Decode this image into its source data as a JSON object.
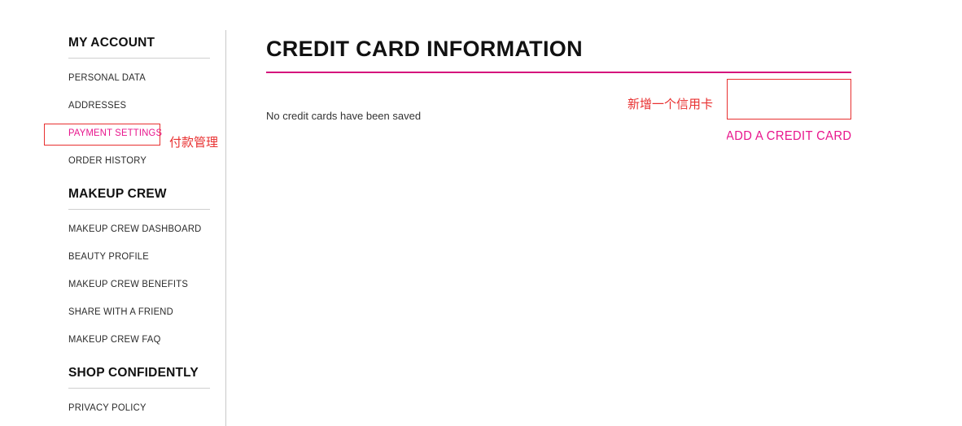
{
  "page": {
    "title": "CREDIT CARD INFORMATION",
    "empty_message": "No credit cards have been saved",
    "accent_pink": "#e8148c",
    "title_rule_color": "#d5157d",
    "annotation_color": "#e83030"
  },
  "actions": {
    "add_credit_card_label": "ADD A CREDIT CARD"
  },
  "annotations": [
    {
      "id": "payment-settings",
      "text": "付款管理",
      "target": "PAYMENT SETTINGS"
    },
    {
      "id": "add-credit-card",
      "text": "新增一个信用卡",
      "target": "ADD A CREDIT CARD"
    }
  ],
  "annotation_payment": "付款管理",
  "annotation_addcard": "新增一个信用卡",
  "sidebar": {
    "groups": [
      {
        "title": "MY ACCOUNT",
        "items": [
          {
            "label": "PERSONAL DATA",
            "active": false
          },
          {
            "label": "ADDRESSES",
            "active": false
          },
          {
            "label": "PAYMENT SETTINGS",
            "active": true
          },
          {
            "label": "ORDER HISTORY",
            "active": false
          }
        ]
      },
      {
        "title": "MAKEUP CREW",
        "items": [
          {
            "label": "MAKEUP CREW DASHBOARD",
            "active": false
          },
          {
            "label": "BEAUTY PROFILE",
            "active": false
          },
          {
            "label": "MAKEUP CREW BENEFITS",
            "active": false
          },
          {
            "label": "SHARE WITH A FRIEND",
            "active": false
          },
          {
            "label": "MAKEUP CREW FAQ",
            "active": false
          }
        ]
      },
      {
        "title": "SHOP CONFIDENTLY",
        "items": [
          {
            "label": "PRIVACY POLICY",
            "active": false
          }
        ]
      }
    ]
  }
}
